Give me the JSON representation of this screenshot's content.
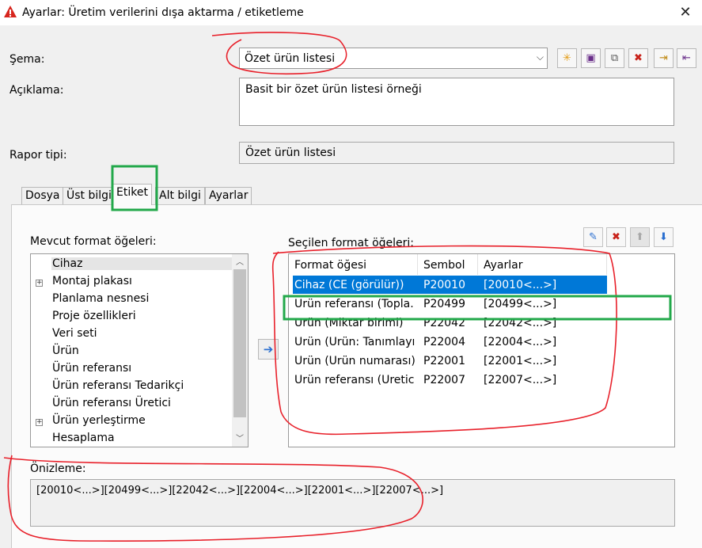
{
  "window": {
    "title": "Ayarlar: Üretim verilerini dışa aktarma / etiketleme",
    "close_glyph": "✕"
  },
  "schema": {
    "label": "Şema:",
    "value": "Özet ürün listesi",
    "arrow_glyph": "⌵"
  },
  "toolbar": {
    "icons": [
      "new-icon",
      "save-icon",
      "copy-icon",
      "delete-icon",
      "import-icon",
      "export-icon"
    ],
    "glyphs": [
      "✳",
      "▣",
      "⧉",
      "✖",
      "⇥",
      "⇤"
    ]
  },
  "description": {
    "label": "Açıklama:",
    "value": "Basit bir özet ürün listesi örneği"
  },
  "report_type": {
    "label": "Rapor tipi:",
    "value": "Özet ürün listesi"
  },
  "tabs": [
    {
      "label": "Dosya"
    },
    {
      "label": "Üst bilgi"
    },
    {
      "label": "Etiket"
    },
    {
      "label": "Alt bilgi"
    },
    {
      "label": "Ayarlar"
    }
  ],
  "available": {
    "label": "Mevcut format öğeleri:",
    "items": [
      {
        "label": "Cihaz",
        "expandable": false
      },
      {
        "label": "Montaj plakası",
        "expandable": true
      },
      {
        "label": "Planlama nesnesi",
        "expandable": false
      },
      {
        "label": "Proje özellikleri",
        "expandable": false
      },
      {
        "label": "Veri seti",
        "expandable": false
      },
      {
        "label": "Ürün",
        "expandable": false
      },
      {
        "label": "Ürün referansı",
        "expandable": false
      },
      {
        "label": "Ürün referansı Tedarikçi",
        "expandable": false
      },
      {
        "label": "Ürün referansı Üretici",
        "expandable": false
      },
      {
        "label": "Ürün yerleştirme",
        "expandable": true
      },
      {
        "label": "Hesaplama",
        "expandable": false
      }
    ],
    "plus_glyph": "+",
    "scroll_up_glyph": "︿",
    "scroll_down_glyph": "﹀"
  },
  "move_glyph": "➔",
  "selected": {
    "label": "Seçilen format öğeleri:",
    "columns": [
      "Format öğesi",
      "Sembol",
      "Ayarlar"
    ],
    "rows": [
      [
        "Cihaz (CE (görülür))",
        "P20010",
        "[20010<...>]"
      ],
      [
        "Ürün referansı (Topla...",
        "P20499",
        "[20499<...>]"
      ],
      [
        "Ürün (Miktar birimi)",
        "P22042",
        "[22042<...>]"
      ],
      [
        "Ürün (Ürün: Tanımlayı...",
        "P22004",
        "[22004<...>]"
      ],
      [
        "Ürün (Ürün numarası)",
        "P22001",
        "[22001<...>]"
      ],
      [
        "Ürün referansı (Üretici)",
        "P22007",
        "[22007<...>]"
      ]
    ],
    "toolbar_glyphs": [
      "✎",
      "✖",
      "⬆",
      "⬇"
    ]
  },
  "preview": {
    "label": "Önizleme:",
    "value": "[20010<...>][20499<...>][22042<...>][22004<...>][22001<...>][22007<...>]"
  },
  "colors": {
    "selection": "#0078d7",
    "annotation_red": "#e8202a",
    "annotation_green": "#22a84a"
  }
}
